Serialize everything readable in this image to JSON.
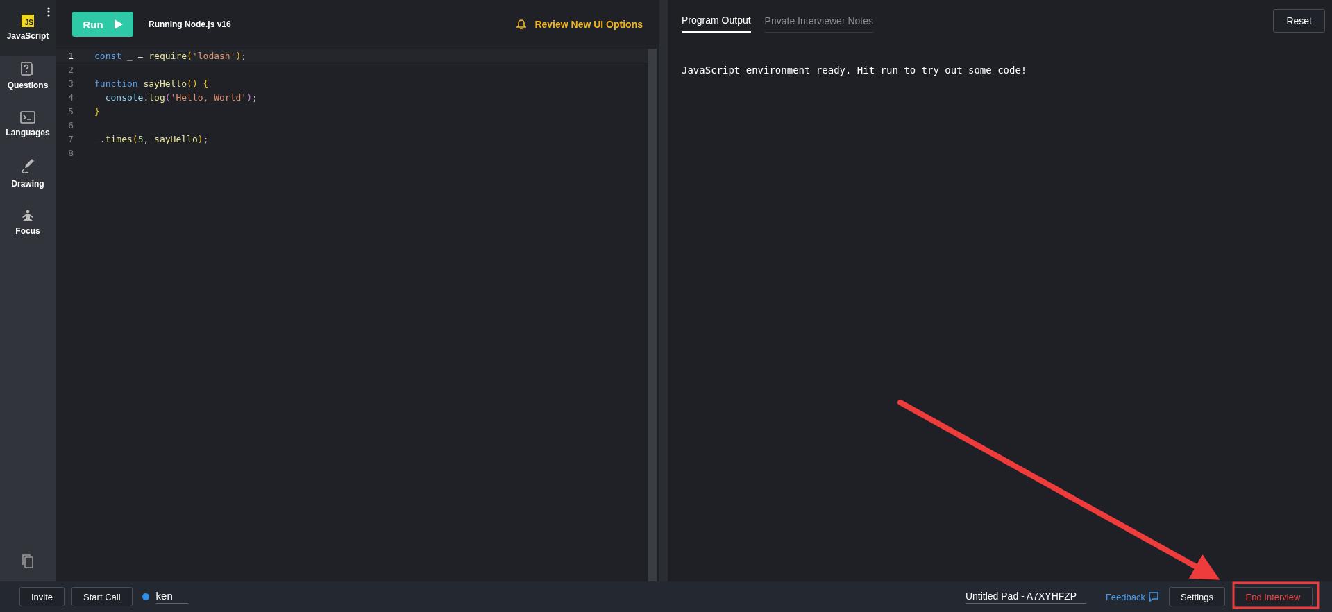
{
  "sidebar": {
    "language": {
      "badge": "JS",
      "label": "JavaScript"
    },
    "items": [
      {
        "kind": "questions",
        "label": "Questions"
      },
      {
        "kind": "languages",
        "label": "Languages"
      },
      {
        "kind": "drawing",
        "label": "Drawing"
      },
      {
        "kind": "focus",
        "label": "Focus"
      }
    ]
  },
  "toolbar": {
    "run_button": "Run",
    "runtime": "Running Node.js v16",
    "notice": "Review New UI Options"
  },
  "editor": {
    "lines": [
      {
        "number": "1",
        "current": true,
        "tokens": [
          {
            "kind": "keyword",
            "text": "const"
          },
          {
            "kind": "plain",
            "text": " _ = "
          },
          {
            "kind": "call",
            "text": "require"
          },
          {
            "kind": "paren",
            "text": "("
          },
          {
            "kind": "string",
            "text": "'lodash'"
          },
          {
            "kind": "paren",
            "text": ")"
          },
          {
            "kind": "plain",
            "text": ";"
          }
        ]
      },
      {
        "number": "2",
        "current": false
      },
      {
        "number": "3",
        "current": false,
        "tokens": [
          {
            "kind": "keyword",
            "text": "function"
          },
          {
            "kind": "call",
            "text": " sayHello"
          },
          {
            "kind": "paren",
            "text": "() {"
          }
        ]
      },
      {
        "number": "4",
        "current": false,
        "tokens": [
          {
            "kind": "ident",
            "text": "  console"
          },
          {
            "kind": "plain",
            "text": "."
          },
          {
            "kind": "call",
            "text": "log"
          },
          {
            "kind": "paren2",
            "text": "("
          },
          {
            "kind": "string",
            "text": "'Hello, World'"
          },
          {
            "kind": "paren2",
            "text": ")"
          },
          {
            "kind": "plain",
            "text": ";"
          }
        ]
      },
      {
        "number": "5",
        "current": false,
        "tokens": [
          {
            "kind": "paren",
            "text": "}"
          }
        ]
      },
      {
        "number": "6",
        "current": false
      },
      {
        "number": "7",
        "current": false,
        "tokens": [
          {
            "kind": "plain",
            "text": "_."
          },
          {
            "kind": "call",
            "text": "times"
          },
          {
            "kind": "paren",
            "text": "("
          },
          {
            "kind": "number",
            "text": "5"
          },
          {
            "kind": "plain",
            "text": ", "
          },
          {
            "kind": "call",
            "text": "sayHello"
          },
          {
            "kind": "paren",
            "text": ")"
          },
          {
            "kind": "plain",
            "text": ";"
          }
        ]
      },
      {
        "number": "8",
        "current": false
      }
    ]
  },
  "output": {
    "tabs": [
      {
        "label": "Program Output",
        "selected": true
      },
      {
        "label": "Private Interviewer Notes",
        "selected": false
      }
    ],
    "reset_button": "Reset",
    "message": "JavaScript environment ready. Hit run to try out some code!"
  },
  "bottom_bar": {
    "invite_button": "Invite",
    "start_call_button": "Start Call",
    "user": {
      "name": "ken",
      "color": "#2f8fe8"
    },
    "pad_title": "Untitled Pad - A7XYHFZP",
    "feedback_link": "Feedback",
    "settings_button": "Settings",
    "end_button": "End Interview"
  }
}
